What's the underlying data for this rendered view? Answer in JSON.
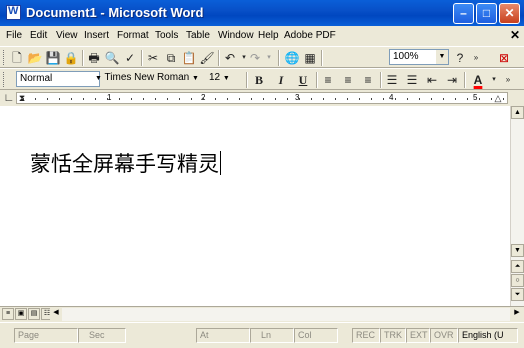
{
  "window": {
    "title": "Document1 - Microsoft Word"
  },
  "menu": [
    "File",
    "Edit",
    "View",
    "Insert",
    "Format",
    "Tools",
    "Table",
    "Window",
    "Help",
    "Adobe PDF"
  ],
  "toolbar": {
    "zoom": "100%"
  },
  "format": {
    "style": "Normal",
    "font": "Times New Roman",
    "size": "12",
    "bold": "B",
    "italic": "I",
    "underline": "U",
    "font_color": "A"
  },
  "ruler": {
    "numbers": [
      "1",
      "2",
      "3",
      "4",
      "5"
    ]
  },
  "document": {
    "text": "蒙恬全屏幕手写精灵"
  },
  "status": {
    "page": "Page",
    "sec": "Sec",
    "at": "At",
    "ln": "Ln",
    "col": "Col",
    "rec": "REC",
    "trk": "TRK",
    "ext": "EXT",
    "ovr": "OVR",
    "lang": "English (U"
  },
  "colors": {
    "title_bar": "#0a5fd8",
    "font_color_bar": "#ff0000"
  }
}
